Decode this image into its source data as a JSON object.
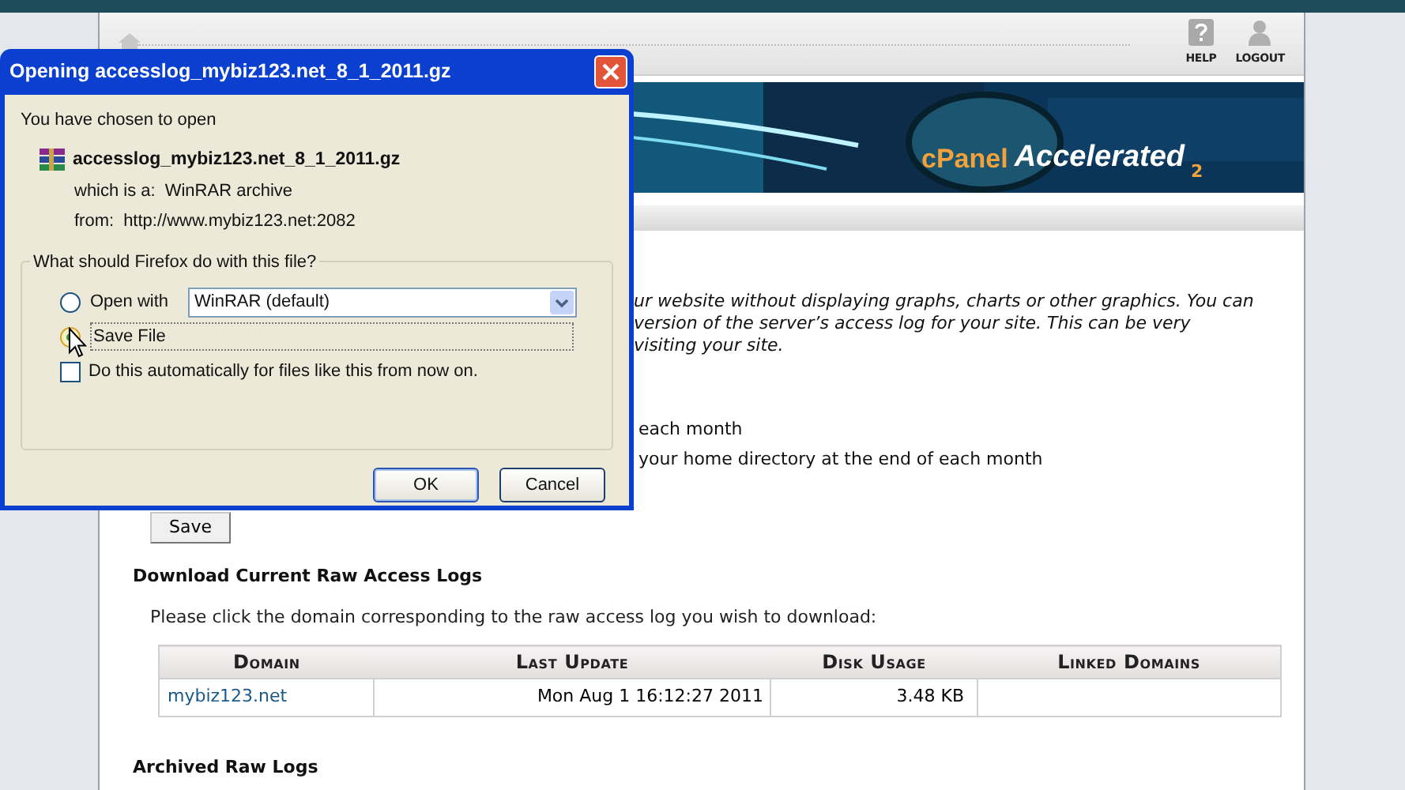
{
  "page": {
    "toolbar": [
      {
        "kind": "help",
        "label": "HELP"
      },
      {
        "kind": "logout",
        "label": "LOGOUT"
      }
    ],
    "banner": {
      "logo": "cPanel",
      "product": "Accelerated",
      "version": "2"
    },
    "description_fragments": [
      "ur website without displaying graphs, charts or other graphics. You can",
      "version of the server’s access log for your site. This can be very",
      "visiting your site."
    ],
    "option_fragments": [
      "each month",
      "your home directory at the end of each month"
    ],
    "save_button": "Save",
    "download": {
      "heading": "Download Current Raw Access Logs",
      "instructions": "Please click the domain corresponding to the raw access log you wish to download:",
      "columns": [
        "Domain",
        "Last Update",
        "Disk Usage",
        "Linked Domains"
      ],
      "rows": [
        {
          "domain": "mybiz123.net",
          "last_update": "Mon Aug 1 16:12:27 2011",
          "disk_usage": "3.48 KB"
        }
      ]
    },
    "archived_heading": "Archived Raw Logs"
  },
  "dialog": {
    "title": "Opening accesslog_mybiz123.net_8_1_2011.gz",
    "intro": "You have chosen to open",
    "file_name": "accesslog_mybiz123.net_8_1_2011.gz",
    "type_label": "which is a:",
    "type": "WinRAR archive",
    "from_label": "from:",
    "from": "http://www.mybiz123.net:2082",
    "group_label": "What should Firefox do with this file?",
    "actions": [
      {
        "kind": "open_with",
        "label": "Open with",
        "selected": false,
        "app": "WinRAR (default)"
      },
      {
        "kind": "save",
        "label": "Save File",
        "selected": true
      }
    ],
    "auto": {
      "label": "Do this automatically for files like this from now on.",
      "checked": false
    },
    "buttons": [
      "OK",
      "Cancel"
    ]
  }
}
